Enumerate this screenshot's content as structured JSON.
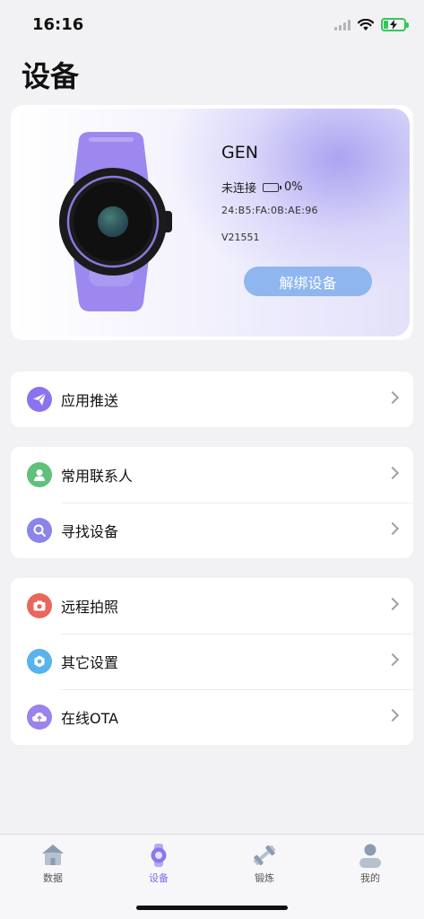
{
  "status_bar": {
    "time": "16:16",
    "icons": [
      "signal-icon",
      "wifi-icon",
      "battery-charging-icon"
    ]
  },
  "page": {
    "title": "设备"
  },
  "device": {
    "name": "GEN",
    "status": "未连接",
    "battery": "0%",
    "mac": "24:B5:FA:0B:AE:96",
    "version": "V21551",
    "unbind_label": "解绑设备",
    "colors": {
      "watch_band": "#a08ef0",
      "accent_glow": "#b4abf2",
      "button": "#8fb6ee"
    }
  },
  "menu_groups": [
    {
      "items": [
        {
          "label": "应用推送",
          "icon": "paper-plane-icon",
          "color": "#8b72ee"
        }
      ]
    },
    {
      "items": [
        {
          "label": "常用联系人",
          "icon": "contact-person-icon",
          "color": "#5ec27a"
        },
        {
          "label": "寻找设备",
          "icon": "search-icon",
          "color": "#8a85e8"
        }
      ]
    },
    {
      "items": [
        {
          "label": "远程拍照",
          "icon": "camera-icon",
          "color": "#e8675c"
        },
        {
          "label": "其它设置",
          "icon": "settings-hex-icon",
          "color": "#58b3ee"
        },
        {
          "label": "在线OTA",
          "icon": "cloud-upload-icon",
          "color": "#9c82ec"
        }
      ]
    }
  ],
  "tab_bar": {
    "tabs": [
      {
        "label": "数据",
        "icon": "house-icon"
      },
      {
        "label": "设备",
        "icon": "watch-icon",
        "active": true
      },
      {
        "label": "锻炼",
        "icon": "dumbbell-icon"
      },
      {
        "label": "我的",
        "icon": "person-icon"
      }
    ],
    "active_color": "#7b6ce8"
  }
}
